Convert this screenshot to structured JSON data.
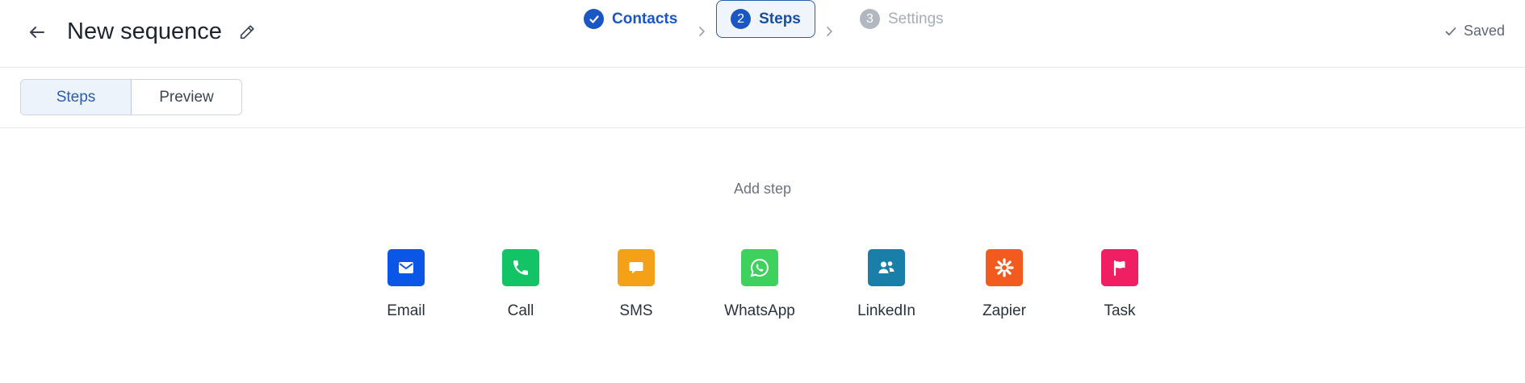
{
  "header": {
    "title": "New sequence",
    "back_icon": "arrow-left-icon",
    "edit_icon": "pencil-icon",
    "stepper": [
      {
        "label": "Contacts",
        "marker": "",
        "state": "completed"
      },
      {
        "label": "Steps",
        "marker": "2",
        "state": "active"
      },
      {
        "label": "Settings",
        "marker": "3",
        "state": "upcoming"
      }
    ],
    "status": "Saved"
  },
  "tabs": [
    {
      "label": "Steps",
      "selected": true
    },
    {
      "label": "Preview",
      "selected": false
    }
  ],
  "main": {
    "heading": "Add step",
    "step_types": [
      {
        "label": "Email",
        "icon": "envelope-icon",
        "color": "#0a56e6"
      },
      {
        "label": "Call",
        "icon": "phone-icon",
        "color": "#12c466"
      },
      {
        "label": "SMS",
        "icon": "chat-bubble-icon",
        "color": "#f5a117"
      },
      {
        "label": "WhatsApp",
        "icon": "whatsapp-icon",
        "color": "#3fd15e"
      },
      {
        "label": "LinkedIn",
        "icon": "people-icon",
        "color": "#1a7fa8"
      },
      {
        "label": "Zapier",
        "icon": "asterisk-icon",
        "color": "#f25a1e"
      },
      {
        "label": "Task",
        "icon": "flag-icon",
        "color": "#f01e62"
      }
    ]
  },
  "colors": {
    "accent": "#1a56c4",
    "border": "#e3e6ea",
    "muted": "#a6adb7"
  }
}
